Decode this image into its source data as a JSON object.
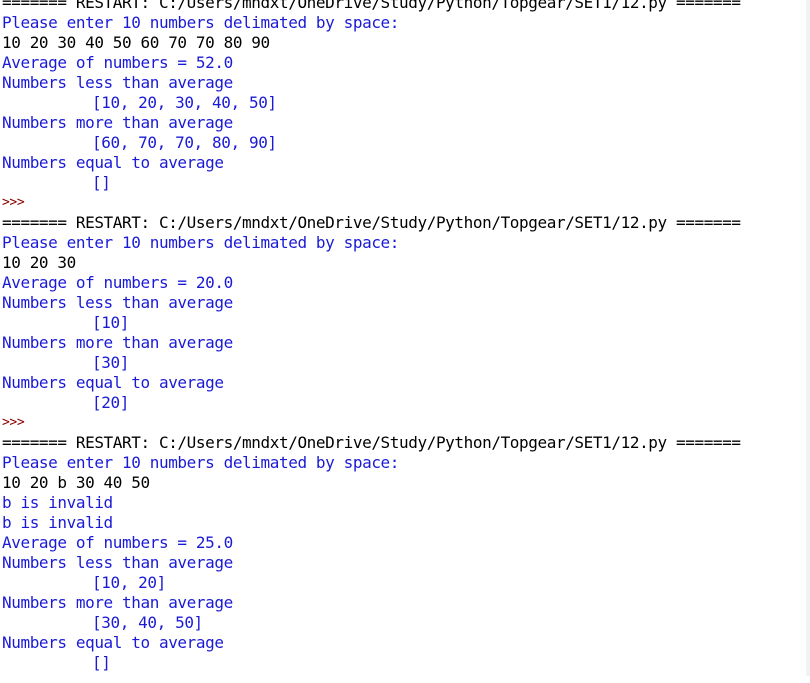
{
  "window": {
    "prompt": ">>>"
  },
  "sessions": [
    {
      "restart": "======= RESTART: C:/Users/mndxt/OneDrive/Study/Python/Topgear/SET1/12.py =======",
      "input_prompt": "Please enter 10 numbers delimated by space:",
      "user_input": "10 20 30 40 50 60 70 70 80 90",
      "invalid_lines": [],
      "average": "Average of numbers = 52.0",
      "less_label": "Numbers less than average",
      "less_value": "[10, 20, 30, 40, 50]",
      "more_label": "Numbers more than average",
      "more_value": "[60, 70, 70, 80, 90]",
      "equal_label": "Numbers equal to average",
      "equal_value": "[]"
    },
    {
      "restart": "======= RESTART: C:/Users/mndxt/OneDrive/Study/Python/Topgear/SET1/12.py =======",
      "input_prompt": "Please enter 10 numbers delimated by space:",
      "user_input": "10 20 30",
      "invalid_lines": [],
      "average": "Average of numbers = 20.0",
      "less_label": "Numbers less than average",
      "less_value": "[10]",
      "more_label": "Numbers more than average",
      "more_value": "[30]",
      "equal_label": "Numbers equal to average",
      "equal_value": "[20]"
    },
    {
      "restart": "======= RESTART: C:/Users/mndxt/OneDrive/Study/Python/Topgear/SET1/12.py =======",
      "input_prompt": "Please enter 10 numbers delimated by space:",
      "user_input": "10 20 b 30 40 50",
      "invalid_lines": [
        "b is invalid",
        "b is invalid"
      ],
      "average": "Average of numbers = 25.0",
      "less_label": "Numbers less than average",
      "less_value": "[10, 20]",
      "more_label": "Numbers more than average",
      "more_value": "[30, 40, 50]",
      "equal_label": "Numbers equal to average",
      "equal_value": "[]"
    }
  ]
}
